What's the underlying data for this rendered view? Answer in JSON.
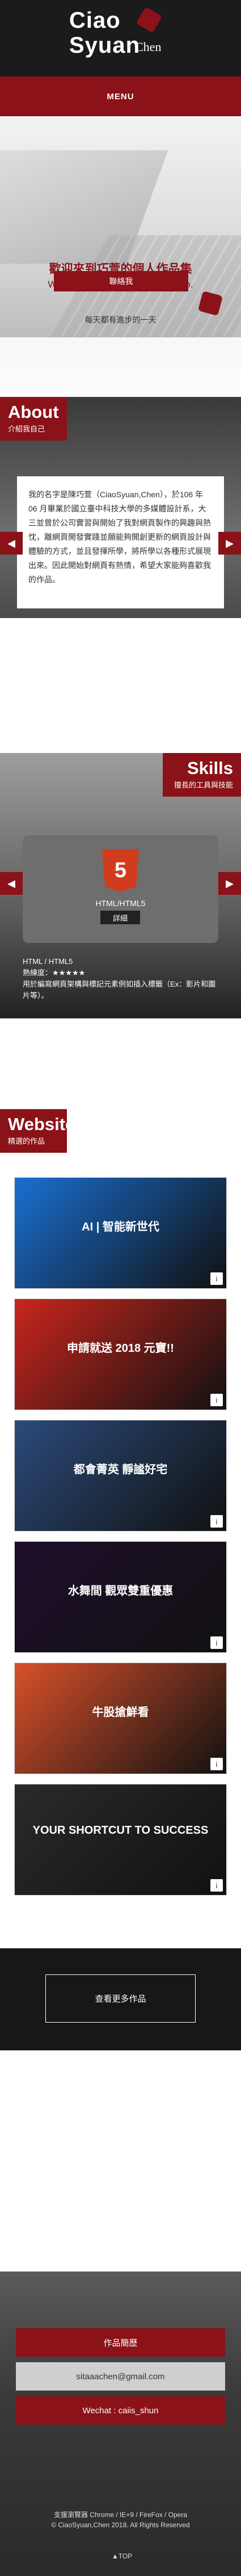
{
  "header": {
    "logo_line1": "Ciao",
    "logo_line2": "Syuan",
    "logo_script": "Chen",
    "menu_label": "MENU"
  },
  "hero": {
    "title_zh": "歡迎來到巧萱的個人作品集",
    "title_en": "Welcome to Ciaosyuan's portfolio.",
    "subtitle": "每天都有進步的一天",
    "button_label": "聯絡我"
  },
  "about": {
    "heading": "About",
    "subheading": "介紹我自己",
    "body": "我的名字是陳巧萱（CiaoSyuan,Chen），於106 年 06 月畢業於國立臺中科技大學的多媒體設計系，大三並曾於公司實習與開始了我對網頁製作的興趣與熱忱，離網頁開發實踐並願能夠開創更新的網頁設計與體驗的方式，並且發揮所學，將所學以各種形式展現出來。因此開始對網頁有熱情，希望大家能夠喜歡我的作品。"
  },
  "skills": {
    "heading": "Skills",
    "subheading": "擅長的工具與技能",
    "card_label": "HTML/HTML5",
    "detail_button": "詳細",
    "info_title": "HTML / HTML5",
    "info_level": "熟練度：★★★★★",
    "info_desc": "用於編寫網頁架構與標記元素例如插入標籤（Ex：影片和圖片等）。"
  },
  "website": {
    "heading": "Website",
    "subheading": "精選的作品",
    "shots": [
      {
        "name": "ai-event-shot",
        "caption": "AI | 智能新世代",
        "bg": "#1a6fd0"
      },
      {
        "name": "2018-new-year-shot",
        "caption": "申請就送 2018 元寶!!",
        "bg": "#c8261d"
      },
      {
        "name": "property-shot",
        "caption": "都會菁英 靜謐好宅",
        "bg": "#2b4a7a"
      },
      {
        "name": "show-shot",
        "caption": "水舞間 觀眾雙重優惠",
        "bg": "#1e0e2b"
      },
      {
        "name": "niu-shot",
        "caption": "牛股搶鮮看",
        "bg": "#d8502a"
      },
      {
        "name": "success-shot",
        "caption": "YOUR SHORTCUT TO SUCCESS",
        "bg": "#2a2a2a"
      }
    ],
    "more_button": "查看更多作品"
  },
  "footer": {
    "contact_label": "作品簡歷",
    "email": "sitaaachen@gmail.com",
    "wechat": "Wechat : caiis_shun",
    "browser_note": "支援瀏覽器 Chrome / IE+9 / FireFox / Opera",
    "copyright": "© CiaoSyuan,Chen 2018. All Rights Reserved",
    "to_top": "▲TOP"
  },
  "colors": {
    "brand": "#8b1218",
    "dark": "#1b1b1b"
  }
}
